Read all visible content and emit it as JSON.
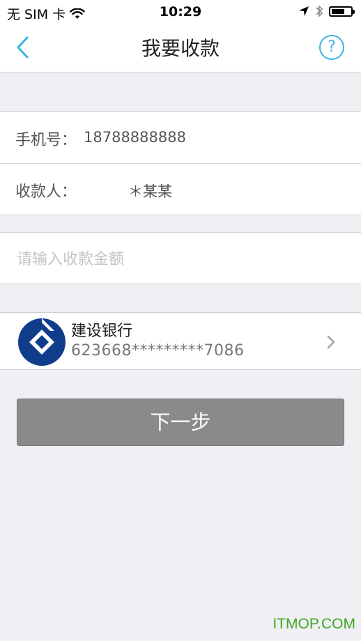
{
  "status_bar": {
    "carrier": "无 SIM 卡",
    "time": "10:29",
    "wifi_icon": "wifi-icon",
    "location_icon": "location-arrow-icon",
    "bluetooth_icon": "bluetooth-icon",
    "battery_icon": "battery-icon",
    "battery_level": 0.7
  },
  "nav": {
    "back_icon": "chevron-left-icon",
    "title": "我要收款",
    "help_label": "?",
    "accent_color": "#3ab3e6"
  },
  "payee": {
    "phone_label": "手机号：",
    "phone_value": "18788888888",
    "name_label": "收款人：",
    "name_value": "＊某某"
  },
  "amount": {
    "value": "",
    "placeholder": "请输入收款金额"
  },
  "bank": {
    "logo_icon": "ccb-bank-logo-icon",
    "name": "建设银行",
    "card_number": "623668*********7086",
    "chevron_icon": "chevron-right-icon",
    "brand_color": "#0f3d8c"
  },
  "actions": {
    "next_label": "下一步",
    "button_color": "#8a8a8a"
  },
  "watermark": "ITMOP.COM"
}
